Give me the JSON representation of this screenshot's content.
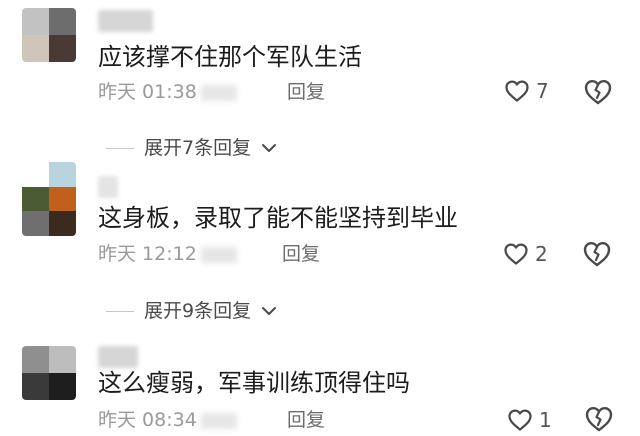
{
  "comments": [
    {
      "text": "应该撑不住那个军队生活",
      "time": "昨天 01:38",
      "reply_label": "回复",
      "likes": "7",
      "avatar_colors": [
        "#c2c2c2",
        "#6d6d6d",
        "#cfc5b9",
        "#4a3a36"
      ]
    },
    {
      "text": "这身板，录取了能不能坚持到毕业",
      "time": "昨天 12:12",
      "reply_label": "回复",
      "likes": "2",
      "avatar_colors": [
        "#b9d3df",
        "#3c3c3c",
        "#4b5b33",
        "#c0601a",
        "#3b2a1f",
        "#6f6f6f"
      ]
    },
    {
      "text": "这么瘦弱，军事训练顶得住吗",
      "time": "昨天 08:34",
      "reply_label": "回复",
      "likes": "1",
      "avatar_colors": [
        "#8f8f8f",
        "#bdbdbd",
        "#3a3a3a",
        "#1e1e1e"
      ]
    }
  ],
  "expands": [
    {
      "label": "展开7条回复"
    },
    {
      "label": "展开9条回复"
    }
  ],
  "icons": {
    "like": "heart-outline-icon",
    "dislike": "broken-heart-icon",
    "expand": "chevron-down-icon"
  }
}
